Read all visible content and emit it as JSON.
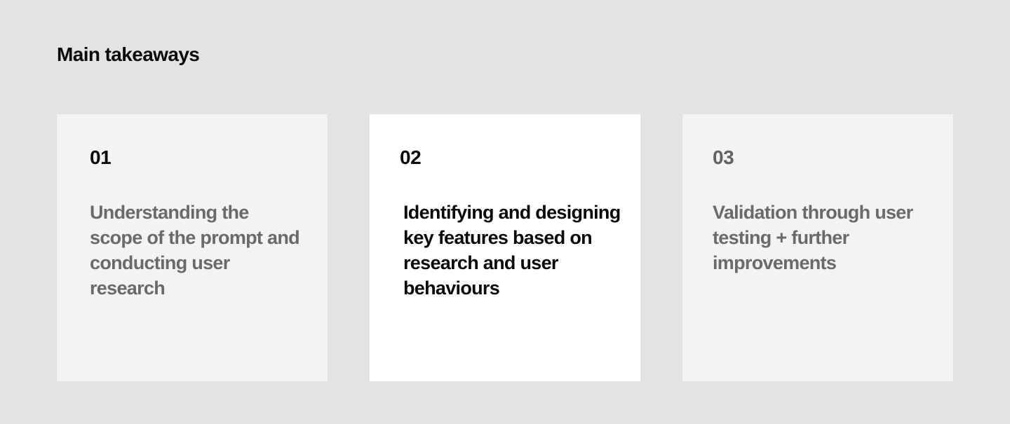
{
  "section": {
    "title": "Main takeaways"
  },
  "cards": [
    {
      "number": "01",
      "text": "Understanding the scope of the prompt and conducting user research"
    },
    {
      "number": "02",
      "text": "Identifying and designing key features based on research and user behaviours"
    },
    {
      "number": "03",
      "text": "Validation through user testing + further improvements"
    }
  ],
  "colors": {
    "page_background": "#e3e3e3",
    "card_background": "#f3f3f3",
    "card_active_background": "#ffffff",
    "text_primary": "#0a0a0a",
    "text_muted": "#6a6a6a"
  }
}
